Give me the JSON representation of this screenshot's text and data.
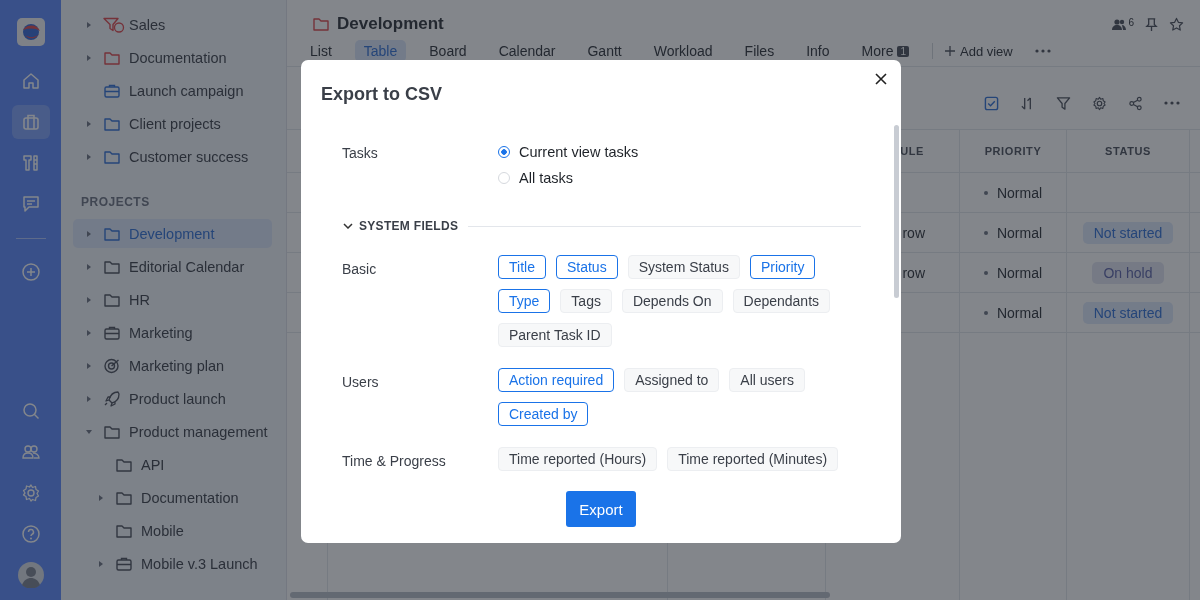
{
  "rail": [
    {
      "kind": "home",
      "selected": false
    },
    {
      "kind": "briefcase",
      "selected": true
    },
    {
      "kind": "tools",
      "selected": false
    },
    {
      "kind": "chat",
      "selected": false
    },
    {
      "kind": "plus",
      "selected": false
    }
  ],
  "rail_bottom": [
    {
      "kind": "search"
    },
    {
      "kind": "users"
    },
    {
      "kind": "settings"
    },
    {
      "kind": "help"
    },
    {
      "kind": "avatar"
    }
  ],
  "sidebar": {
    "top_items": [
      {
        "label": "Sales",
        "kind": "funnel",
        "expandable": true,
        "expanded": false,
        "selected": false
      },
      {
        "label": "Documentation",
        "kind": "red_folder",
        "expandable": true,
        "expanded": false,
        "selected": false
      },
      {
        "label": "Launch campaign",
        "kind": "blue_briefcase",
        "expandable": false,
        "selected": false
      },
      {
        "label": "Client projects",
        "kind": "blue_folder",
        "expandable": true,
        "expanded": false,
        "selected": false
      },
      {
        "label": "Customer success",
        "kind": "blue_folder",
        "expandable": true,
        "expanded": false,
        "selected": false
      }
    ],
    "section_label": "PROJECTS",
    "projects": [
      {
        "label": "Development",
        "kind": "blue_folder",
        "expandable": true,
        "expanded": false,
        "selected": true
      },
      {
        "label": "Editorial Calendar",
        "kind": "folder",
        "expandable": true,
        "expanded": false,
        "selected": false
      },
      {
        "label": "HR",
        "kind": "folder",
        "expandable": true,
        "expanded": false,
        "selected": false
      },
      {
        "label": "Marketing",
        "kind": "briefcase",
        "expandable": true,
        "expanded": false,
        "selected": false
      },
      {
        "label": "Marketing plan",
        "kind": "target",
        "expandable": true,
        "expanded": false,
        "selected": false
      },
      {
        "label": "Product launch",
        "kind": "rocket",
        "expandable": true,
        "expanded": false,
        "selected": false
      },
      {
        "label": "Product management",
        "kind": "folder",
        "expandable": true,
        "expanded": true,
        "selected": false,
        "children": [
          {
            "label": "API",
            "kind": "folder",
            "expandable": false,
            "selected": false
          },
          {
            "label": "Documentation",
            "kind": "folder",
            "expandable": true,
            "expanded": false,
            "selected": false
          },
          {
            "label": "Mobile",
            "kind": "folder",
            "expandable": false,
            "selected": false
          },
          {
            "label": "Mobile v.3 Launch",
            "kind": "briefcase",
            "expandable": true,
            "expanded": false,
            "selected": false
          }
        ]
      }
    ]
  },
  "header": {
    "title": "Development",
    "members_count": "6"
  },
  "tabs": [
    {
      "label": "List",
      "selected": false
    },
    {
      "label": "Table",
      "selected": true
    },
    {
      "label": "Board",
      "selected": false
    },
    {
      "label": "Calendar",
      "selected": false
    },
    {
      "label": "Gantt",
      "selected": false
    },
    {
      "label": "Workload",
      "selected": false
    },
    {
      "label": "Files",
      "selected": false
    },
    {
      "label": "Info",
      "selected": false
    },
    {
      "label": "More",
      "selected": false,
      "badge": "1"
    }
  ],
  "add_view": "Add view",
  "table": {
    "columns": [
      {
        "label": "ULE"
      },
      {
        "label": "PRIORITY"
      },
      {
        "label": "STATUS"
      }
    ],
    "rows": [
      {
        "column_1": "",
        "priority": "Normal"
      },
      {
        "column_1": "row",
        "priority": "Normal",
        "status": {
          "label": "Not started",
          "kind": "not_started"
        }
      },
      {
        "column_1": "row",
        "priority": "Normal",
        "status": {
          "label": "On hold",
          "kind": "on_hold"
        }
      },
      {
        "column_1": "",
        "priority": "Normal",
        "status": {
          "label": "Not started",
          "kind": "not_started"
        }
      }
    ]
  },
  "dialog": {
    "title": "Export to CSV",
    "tasks": {
      "label": "Tasks",
      "options": [
        {
          "label": "Current view tasks",
          "selected": true
        },
        {
          "label": "All tasks",
          "selected": false
        }
      ]
    },
    "section": {
      "title": "SYSTEM FIELDS",
      "expanded": true
    },
    "groups": [
      {
        "label": "Basic",
        "fields": [
          {
            "label": "Title",
            "selected": true
          },
          {
            "label": "Status",
            "selected": true
          },
          {
            "label": "System Status",
            "selected": false
          },
          {
            "label": "Priority",
            "selected": true
          },
          {
            "label": "Type",
            "selected": true
          },
          {
            "label": "Tags",
            "selected": false
          },
          {
            "label": "Depends On",
            "selected": false
          },
          {
            "label": "Dependants",
            "selected": false
          },
          {
            "label": "Parent Task ID",
            "selected": false
          }
        ]
      },
      {
        "label": "Users",
        "fields": [
          {
            "label": "Action required",
            "selected": true
          },
          {
            "label": "Assigned to",
            "selected": false
          },
          {
            "label": "All users",
            "selected": false
          },
          {
            "label": "Created by",
            "selected": true
          }
        ]
      },
      {
        "label": "Time & Progress",
        "fields": [
          {
            "label": "Time reported (Hours)",
            "selected": false
          },
          {
            "label": "Time reported (Minutes)",
            "selected": false
          }
        ]
      }
    ],
    "export_button": "Export"
  }
}
